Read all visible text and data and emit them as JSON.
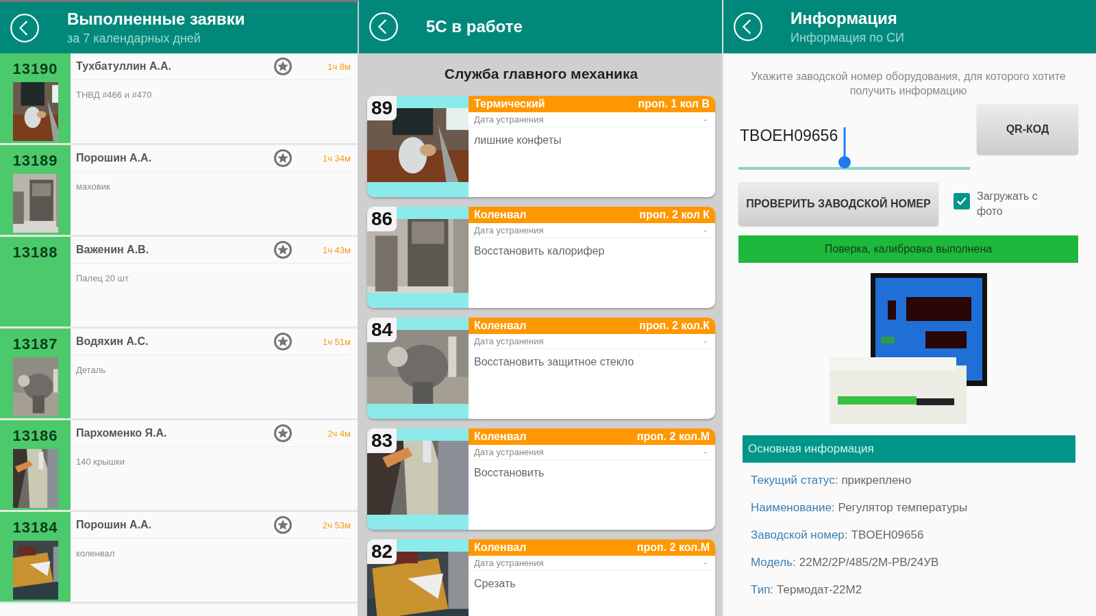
{
  "completed": {
    "title": "Выполненные заявки",
    "subtitle": "за 7 календарных дней",
    "rows": [
      {
        "number": "13190",
        "name": "Тухбатуллин А.А.",
        "time": "1ч 8м",
        "description": "ТНВД #466 и #470"
      },
      {
        "number": "13189",
        "name": "Порошин А.А.",
        "time": "1ч 34м",
        "description": "маховик"
      },
      {
        "number": "13188",
        "name": "Важенин А.В.",
        "time": "1ч 43м",
        "description": "Палец 20 шт"
      },
      {
        "number": "13187",
        "name": "Водяхин А.С.",
        "time": "1ч 51м",
        "description": "Деталь"
      },
      {
        "number": "13186",
        "name": "Пархоменко Я.А.",
        "time": "2ч 4м",
        "description": "140 крышки"
      },
      {
        "number": "13184",
        "name": "Порошин А.А.",
        "time": "2ч 53м",
        "description": "коленвал"
      }
    ]
  },
  "work": {
    "title": "5С в работе",
    "section": "Служба главного механика",
    "cards": [
      {
        "number": "89",
        "category": "Термический",
        "code": "проп. 1 кол В",
        "date_label": "Дата устранения",
        "date": "-",
        "description": "лишние конфеты"
      },
      {
        "number": "86",
        "category": "Коленвал",
        "code": "проп. 2 кол К",
        "date_label": "Дата устранения",
        "date": "-",
        "description": "Восстановить калорифер"
      },
      {
        "number": "84",
        "category": "Коленвал",
        "code": "проп. 2 кол.К",
        "date_label": "Дата устранения",
        "date": "-",
        "description": "Восстановить защитное стекло"
      },
      {
        "number": "83",
        "category": "Коленвал",
        "code": "проп. 2 кол.М",
        "date_label": "Дата устранения",
        "date": "-",
        "description": "Восстановить"
      },
      {
        "number": "82",
        "category": "Коленвал",
        "code": "проп. 2 кол.М",
        "date_label": "Дата устранения",
        "date": "-",
        "description": "Срезать"
      }
    ]
  },
  "info": {
    "title": "Информация",
    "subtitle": "Информация по СИ",
    "instruction": "Укажите заводской номер оборудования, для которого хотите получить информацию",
    "serial_field": {
      "value": "TBOEH09656"
    },
    "qr_button": "QR-КОД",
    "check_button": "ПРОВЕРИТЬ ЗАВОДСКОЙ НОМЕР",
    "photo_checkbox": {
      "label": "Загружать с фото",
      "checked": true
    },
    "status_banner": "Поверка, калибровка выполнена",
    "section": "Основная информация",
    "fields": [
      {
        "label": "Текущий статус:",
        "value": "прикреплено"
      },
      {
        "label": "Наименование:",
        "value": "Регулятор температуры"
      },
      {
        "label": "Заводской номер:",
        "value": "TBOEH09656"
      },
      {
        "label": "Модель:",
        "value": "22M2/2P/485/2M-PB/24УВ"
      },
      {
        "label": "Тип:",
        "value": "Термодат-22M2"
      }
    ]
  }
}
